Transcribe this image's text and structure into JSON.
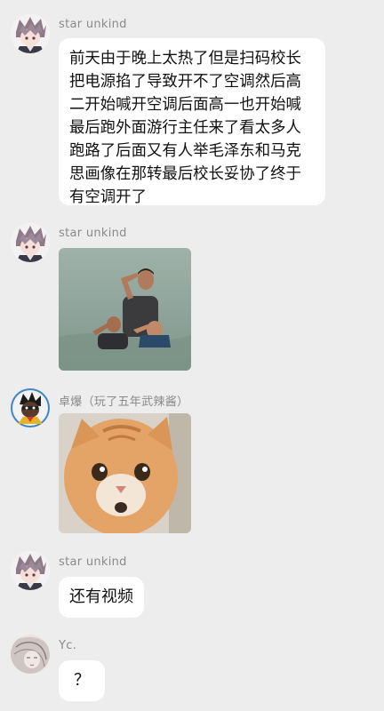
{
  "messages": [
    {
      "sender": "star unkind",
      "avatar_icon": "anime-character-avatar",
      "type": "text",
      "text": "前天由于晚上太热了但是扫码校长把电源掐了导致开不了空调然后高二开始喊开空调后面高一也开始喊最后跑外面游行主任来了看太多人跑路了后面又有人举毛泽东和马克思画像在那转最后校长妥协了终于有空调开了"
    },
    {
      "sender": "star unkind",
      "avatar_icon": "anime-character-avatar",
      "type": "image",
      "image": "men-saluting-in-water-photo"
    },
    {
      "sender": "卓爆（玩了五年武辣酱）",
      "avatar_icon": "cartoon-character-avatar",
      "type": "image",
      "image": "orange-cat-face-photo"
    },
    {
      "sender": "star unkind",
      "avatar_icon": "anime-character-avatar",
      "type": "text",
      "text": "还有视频"
    },
    {
      "sender": "Yc.",
      "avatar_icon": "sketch-portrait-avatar",
      "type": "text",
      "text": "？"
    }
  ],
  "colors": {
    "background": "#ededed",
    "bubble": "#ffffff",
    "sender_name": "#8a8a8a"
  }
}
